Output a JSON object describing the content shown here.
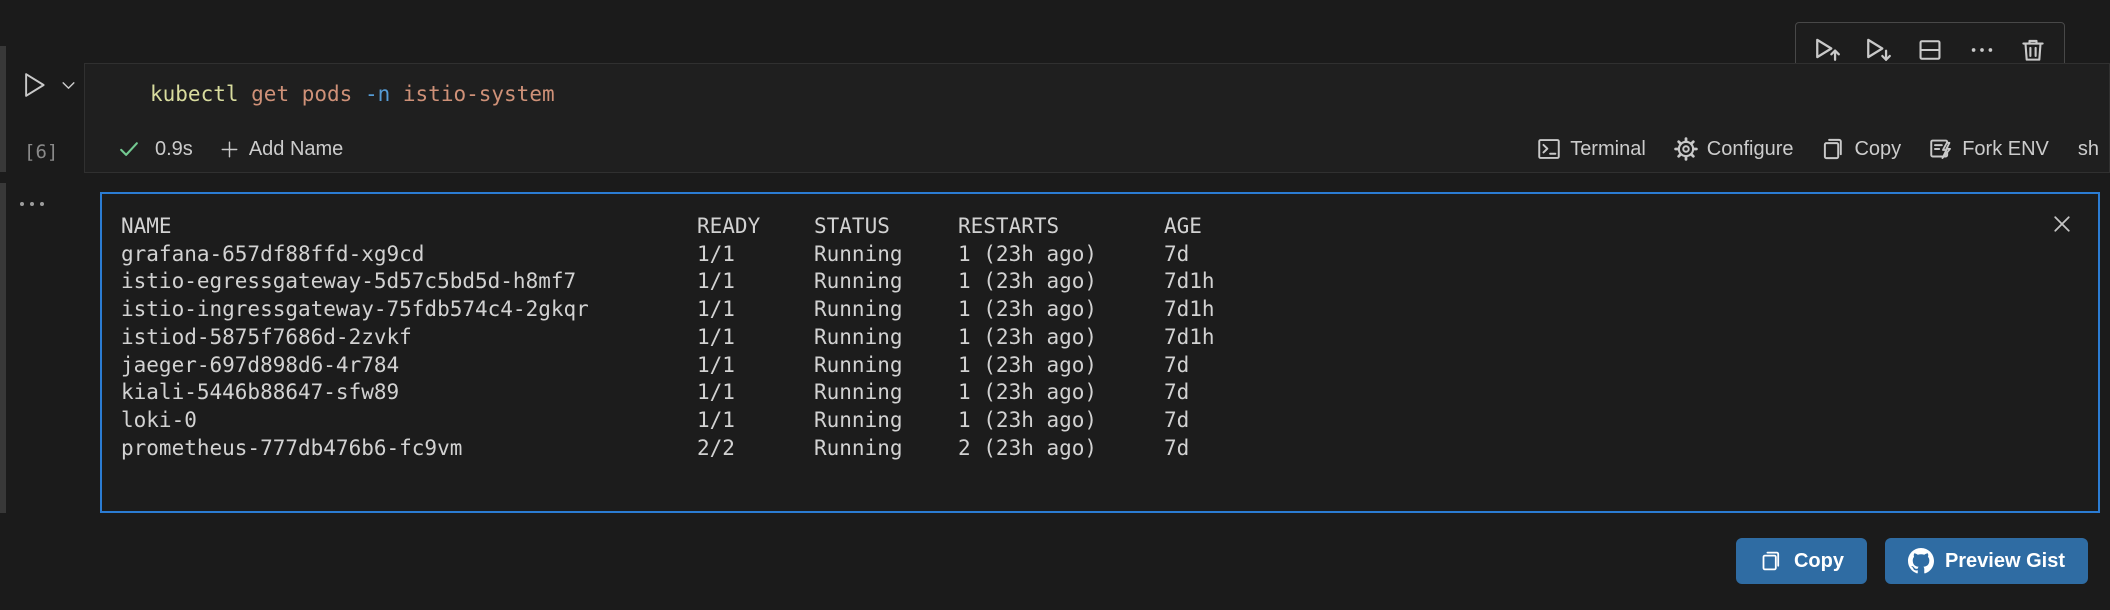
{
  "colors": {
    "background": "#1b1b1b",
    "cell_background": "#1f1f1f",
    "output_border_blue": "#2b7cd3",
    "button_blue": "#2f6ca3",
    "success_green": "#73c991",
    "token_command": "#d8dc9e",
    "token_argument": "#cf9178",
    "token_flag": "#569cd6"
  },
  "cell_toolbar": {
    "buttons": [
      "execute-above",
      "execute-below",
      "split-cell",
      "more-actions",
      "delete-cell"
    ]
  },
  "gutter": {
    "run_button": "play",
    "run_dropdown": "chevron-down",
    "execution_count": "[6]",
    "output_menu": "ellipsis"
  },
  "cell": {
    "code_tokens": [
      {
        "text": "kubectl",
        "color": "#d8dc9e"
      },
      {
        "text": " get pods ",
        "color": "#cf9178"
      },
      {
        "text": "-n",
        "color": "#569cd6"
      },
      {
        "text": " istio-system",
        "color": "#cf9178"
      }
    ],
    "status": {
      "success_icon": "check",
      "duration": "0.9s",
      "add_name_label": "Add Name"
    },
    "actions": [
      {
        "icon": "terminal-icon",
        "label": "Terminal"
      },
      {
        "icon": "gear-icon",
        "label": "Configure"
      },
      {
        "icon": "copy-icon",
        "label": "Copy"
      },
      {
        "icon": "fork-env-icon",
        "label": "Fork ENV"
      }
    ],
    "language_label": "sh"
  },
  "output": {
    "close_icon": "close-x",
    "headers": [
      "NAME",
      "READY",
      "STATUS",
      "RESTARTS",
      "AGE"
    ],
    "rows": [
      {
        "name": "grafana-657df88ffd-xg9cd",
        "ready": "1/1",
        "status": "Running",
        "restarts": "1 (23h ago)",
        "age": "7d"
      },
      {
        "name": "istio-egressgateway-5d57c5bd5d-h8mf7",
        "ready": "1/1",
        "status": "Running",
        "restarts": "1 (23h ago)",
        "age": "7d1h"
      },
      {
        "name": "istio-ingressgateway-75fdb574c4-2gkqr",
        "ready": "1/1",
        "status": "Running",
        "restarts": "1 (23h ago)",
        "age": "7d1h"
      },
      {
        "name": "istiod-5875f7686d-2zvkf",
        "ready": "1/1",
        "status": "Running",
        "restarts": "1 (23h ago)",
        "age": "7d1h"
      },
      {
        "name": "jaeger-697d898d6-4r784",
        "ready": "1/1",
        "status": "Running",
        "restarts": "1 (23h ago)",
        "age": "7d"
      },
      {
        "name": "kiali-5446b88647-sfw89",
        "ready": "1/1",
        "status": "Running",
        "restarts": "1 (23h ago)",
        "age": "7d"
      },
      {
        "name": "loki-0",
        "ready": "1/1",
        "status": "Running",
        "restarts": "1 (23h ago)",
        "age": "7d"
      },
      {
        "name": "prometheus-777db476b6-fc9vm",
        "ready": "2/2",
        "status": "Running",
        "restarts": "2 (23h ago)",
        "age": "7d"
      }
    ]
  },
  "footer": {
    "copy_label": "Copy",
    "preview_gist_label": "Preview Gist"
  }
}
